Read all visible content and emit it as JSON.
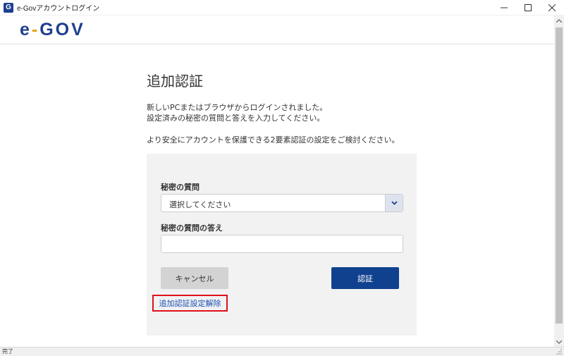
{
  "window": {
    "title": "e-Govアカウントログイン",
    "app_icon": "G",
    "controls": [
      "minimize-icon",
      "maximize-icon",
      "close-icon"
    ]
  },
  "header": {
    "logo_left": "e",
    "logo_dash": "-",
    "logo_right": "GOV"
  },
  "main": {
    "title": "追加認証",
    "desc_line1": "新しいPCまたはブラウザからログインされました。",
    "desc_line2": "設定済みの秘密の質問と答えを入力してください。",
    "desc_line3": "より安全にアカウントを保護できる2要素認証の設定をご検討ください。"
  },
  "form": {
    "question_label": "秘密の質問",
    "question_selected": "選択してください",
    "answer_label": "秘密の質問の答え",
    "answer_value": "",
    "cancel_label": "キャンセル",
    "submit_label": "認証",
    "remove_link": "追加認証設定解除"
  },
  "statusbar": {
    "text": "完了"
  },
  "colors": {
    "brand": "#1e3f8f",
    "accent": "#e0a512",
    "submit": "#10418f",
    "highlight_border": "#e0101b"
  }
}
